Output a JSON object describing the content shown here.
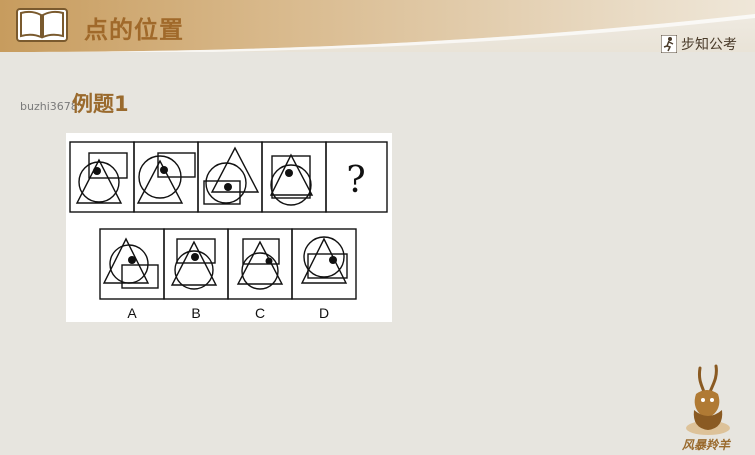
{
  "header": {
    "title": "点的位置",
    "brand": "步知公考"
  },
  "watermark": "buzhi3678",
  "example_label": "例题1",
  "question_mark": "?",
  "options": [
    "A",
    "B",
    "C",
    "D"
  ],
  "logo_text": "风暴羚羊",
  "colors": {
    "accent": "#a0692a",
    "header_band": "#b98d4d",
    "background": "#e7e5df"
  },
  "icons": [
    "book-icon",
    "runner-icon",
    "antelope-logo"
  ]
}
